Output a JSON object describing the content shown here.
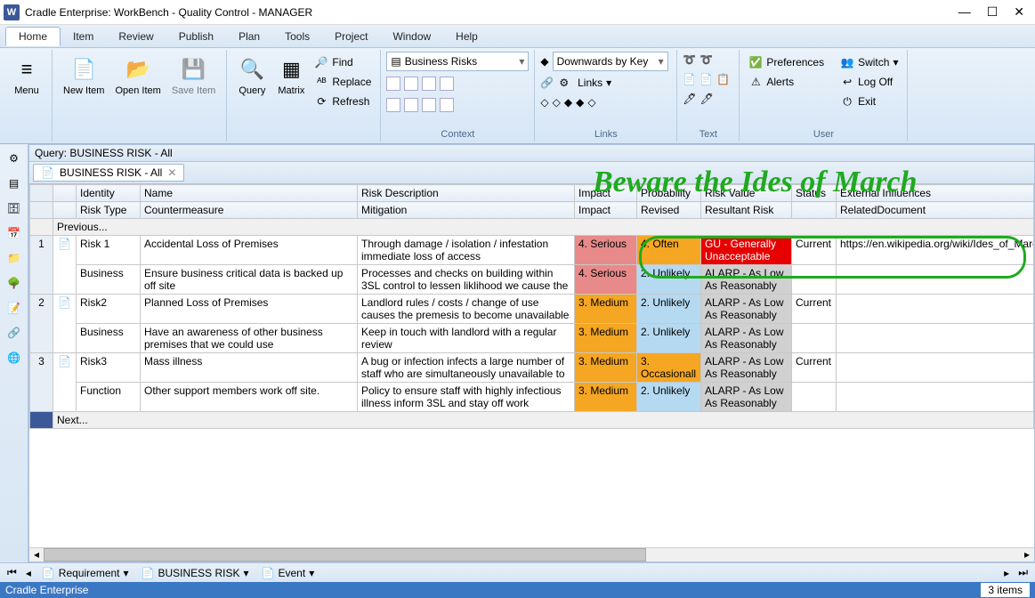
{
  "window": {
    "title": "Cradle Enterprise: WorkBench - Quality Control - MANAGER",
    "app_badge": "W"
  },
  "menubar": [
    "Home",
    "Item",
    "Review",
    "Publish",
    "Plan",
    "Tools",
    "Project",
    "Window",
    "Help"
  ],
  "ribbon": {
    "groups": {
      "menu": {
        "label": "Menu"
      },
      "item": {
        "new": "New\nItem",
        "open": "Open\nItem",
        "save": "Save\nItem"
      },
      "query": {
        "query": "Query",
        "matrix": "Matrix",
        "find": "Find",
        "replace": "Replace",
        "refresh": "Refresh"
      },
      "context": {
        "label": "Context",
        "combo": "Business Risks"
      },
      "links": {
        "label": "Links",
        "combo": "Downwards by Key",
        "links_btn": "Links"
      },
      "text": {
        "label": "Text"
      },
      "user": {
        "label": "User",
        "prefs": "Preferences",
        "alerts": "Alerts",
        "switch": "Switch",
        "logoff": "Log Off",
        "exit": "Exit"
      }
    }
  },
  "query_bar": "Query: BUSINESS RISK - All",
  "tab": "BUSINESS RISK - All",
  "headers": {
    "row1": [
      "",
      "",
      "Identity",
      "Name",
      "Risk Description",
      "Impact",
      "Probability",
      "Risk Value",
      "Status",
      "External Influences"
    ],
    "row2": [
      "",
      "",
      "Risk Type",
      "Countermeasure",
      "Mitigation",
      "Impact",
      "Revised",
      "Resultant Risk",
      "",
      "RelatedDocument"
    ]
  },
  "previous": "Previous...",
  "next": "Next...",
  "rows": [
    {
      "n": "1",
      "identity": "Risk 1",
      "name": "Accidental Loss of Premises",
      "desc": "Through damage / isolation /  infestation immediate loss of access",
      "impact": "4. Serious",
      "impactCls": "cell-serious",
      "prob": "4. Often",
      "probCls": "cell-often",
      "riskval": "GU - Generally Unacceptable",
      "riskCls": "cell-gu",
      "status": "Current",
      "ext": "https://en.wikipedia.org/wiki/Ides_of_March",
      "sub": {
        "type": "Business",
        "counter": "Ensure business critical data is backed up off site",
        "mit": "Processes and checks on building within 3SL control to lessen liklihood we cause the",
        "impact": "4. Serious",
        "impactCls": "cell-serious",
        "prob": "2. Unlikely",
        "probCls": "cell-unlikely",
        "riskval": "ALARP - As Low As Reasonably",
        "riskCls": "cell-alarp"
      }
    },
    {
      "n": "2",
      "identity": "Risk2",
      "name": "Planned Loss of Premises",
      "desc": "Landlord rules / costs / change of use causes the premesis to become unavailable",
      "impact": "3. Medium",
      "impactCls": "cell-medium",
      "prob": "2. Unlikely",
      "probCls": "cell-unlikely",
      "riskval": "ALARP - As Low As Reasonably",
      "riskCls": "cell-alarp",
      "status": "Current",
      "ext": "",
      "sub": {
        "type": "Business",
        "counter": "Have an awareness of other business premises that we could use",
        "mit": "Keep in touch with landlord with a regular review",
        "impact": "3. Medium",
        "impactCls": "cell-medium",
        "prob": "2. Unlikely",
        "probCls": "cell-unlikely",
        "riskval": "ALARP - As Low As Reasonably",
        "riskCls": "cell-alarp"
      }
    },
    {
      "n": "3",
      "identity": "Risk3",
      "name": "Mass illness",
      "desc": "A bug or  infection infects a large number of staff who are simultaneously unavailable to",
      "impact": "3. Medium",
      "impactCls": "cell-medium",
      "prob": "3. Occasionall",
      "probCls": "cell-occasionally",
      "riskval": "ALARP - As Low As Reasonably",
      "riskCls": "cell-alarp",
      "status": "Current",
      "ext": "",
      "sub": {
        "type": "Function",
        "counter": "Other support members work off site.",
        "mit": "Policy to ensure staff with highly infectious illness inform 3SL and stay off work",
        "impact": "3. Medium",
        "impactCls": "cell-medium",
        "prob": "2. Unlikely",
        "probCls": "cell-unlikely",
        "riskval": "ALARP - As Low As Reasonably",
        "riskCls": "cell-alarp"
      }
    }
  ],
  "bottom_nav": {
    "crumbs": [
      "Requirement",
      "BUSINESS RISK",
      "Event"
    ]
  },
  "statusbar": {
    "left": "Cradle Enterprise",
    "right": "3 items"
  },
  "annotation": "Beware the Ides of March"
}
